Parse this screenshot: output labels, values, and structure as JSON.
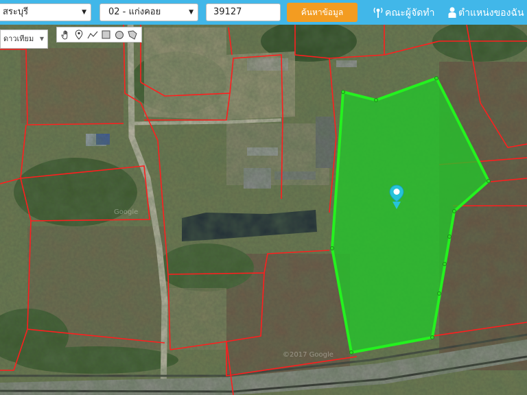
{
  "topbar": {
    "province_select": "สระบุรี",
    "district_select": "02 - แก่งคอย",
    "deed_number_value": "39127",
    "search_button": "ค้นหาข้อมูล",
    "developers_link": "คณะผู้จัดทำ",
    "my_location_link": "ตำแหน่งของฉัน"
  },
  "map_controls": {
    "map_type_select": "ดาวเทียม",
    "draw_tools": [
      "hand-icon",
      "marker-icon",
      "polyline-icon",
      "rectangle-icon",
      "circle-icon",
      "polygon-icon"
    ]
  },
  "map": {
    "watermarks": [
      "Google",
      "©2017 Google"
    ],
    "parcel_border_color": "#ff1e1e",
    "selected_parcel_fill": "#22c52a",
    "selected_parcel_stroke": "#24f21f",
    "marker_color": "#27c3d9"
  }
}
